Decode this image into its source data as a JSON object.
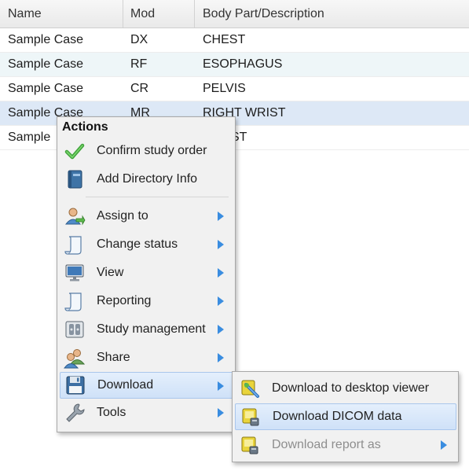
{
  "table": {
    "columns": [
      "Name",
      "Mod",
      "Body Part/Description"
    ],
    "rows": [
      {
        "name": "Sample Case",
        "mod": "DX",
        "desc": "CHEST"
      },
      {
        "name": "Sample Case",
        "mod": "RF",
        "desc": "ESOPHAGUS"
      },
      {
        "name": "Sample Case",
        "mod": "CR",
        "desc": "PELVIS"
      },
      {
        "name": "Sample Case",
        "mod": "MR",
        "desc": "RIGHT WRIST"
      },
      {
        "name": "Sample",
        "mod": "",
        "desc": "ST"
      }
    ]
  },
  "context_menu": {
    "title": "Actions",
    "items": [
      {
        "label": "Confirm study order",
        "icon": "checkmark-icon"
      },
      {
        "label": "Add Directory Info",
        "icon": "book-icon"
      },
      {
        "label": "Assign to",
        "icon": "user-assign-icon",
        "submenu": true
      },
      {
        "label": "Change status",
        "icon": "scroll-icon",
        "submenu": true
      },
      {
        "label": "View",
        "icon": "monitor-icon",
        "submenu": true
      },
      {
        "label": "Reporting",
        "icon": "report-scroll-icon",
        "submenu": true
      },
      {
        "label": "Study management",
        "icon": "film-icon",
        "submenu": true
      },
      {
        "label": "Share",
        "icon": "share-users-icon",
        "submenu": true
      },
      {
        "label": "Download",
        "icon": "floppy-disk-icon",
        "submenu": true
      },
      {
        "label": "Tools",
        "icon": "wrench-icon",
        "submenu": true
      }
    ]
  },
  "download_submenu": {
    "items": [
      {
        "label": "Download to desktop viewer",
        "icon": "desktop-viewer-icon"
      },
      {
        "label": "Download DICOM data",
        "icon": "dicom-download-icon"
      },
      {
        "label": "Download report as",
        "icon": "report-download-icon",
        "submenu": true,
        "disabled": true
      }
    ]
  },
  "colors": {
    "header_bg": "#ececec",
    "alt_row_bg": "#eef6f8",
    "selected_row_bg": "#dde8f6",
    "menu_bg": "#f1f1f1",
    "highlight_bg": "#d8e7fa",
    "submenu_arrow": "#3a8de0"
  }
}
